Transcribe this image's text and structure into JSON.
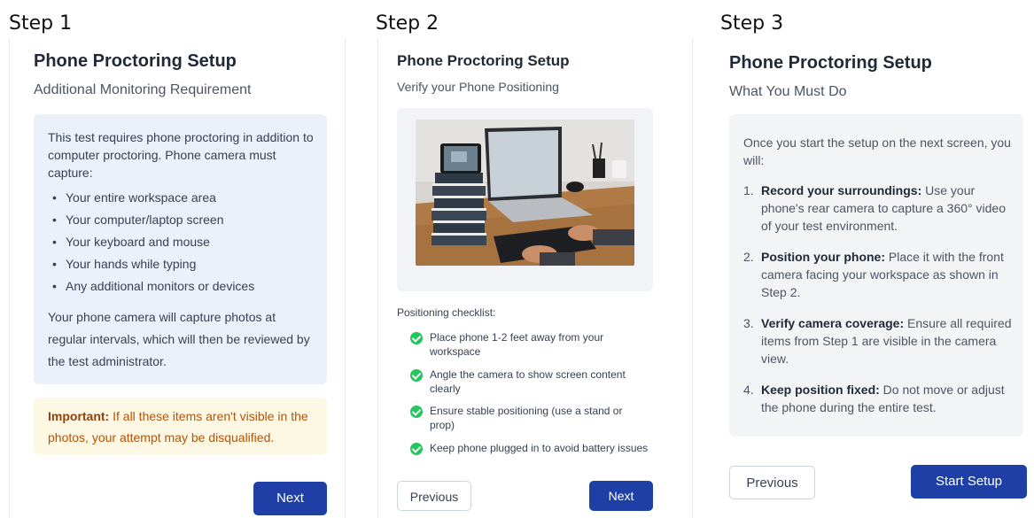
{
  "steps": {
    "step1_label": "Step 1",
    "step2_label": "Step 2",
    "step3_label": "Step 3"
  },
  "step1": {
    "title": "Phone Proctoring Setup",
    "subtitle": "Additional Monitoring Requirement",
    "intro": "This test requires phone proctoring in addition to computer proctoring. Phone camera must capture:",
    "items": [
      "Your entire workspace area",
      "Your computer/laptop screen",
      "Your keyboard and mouse",
      "Your hands while typing",
      "Any additional monitors or devices"
    ],
    "paragraph": "Your phone camera will capture photos at regular intervals, which will then be reviewed by the test administrator.",
    "warning_label": "Important:",
    "warning_text": " If all these items aren't visible in the photos, your attempt may be disqualified.",
    "next_label": "Next"
  },
  "step2": {
    "title": "Phone Proctoring Setup",
    "subtitle": "Verify your Phone Positioning",
    "checklist_title": "Positioning checklist:",
    "checklist": [
      "Place phone 1-2 feet away from your workspace",
      "Angle the camera to show screen content clearly",
      "Ensure stable positioning (use a stand or prop)",
      "Keep phone plugged in to avoid battery issues"
    ],
    "previous_label": "Previous",
    "next_label": "Next"
  },
  "step3": {
    "title": "Phone Proctoring Setup",
    "subtitle": "What You Must Do",
    "intro": "Once you start the setup on the next screen, you will:",
    "items": [
      {
        "num": "1.",
        "bold": "Record your surroundings:",
        "text": " Use your phone's rear camera to capture a 360° video of your test environment."
      },
      {
        "num": "2.",
        "bold": "Position your phone:",
        "text": " Place it with the front camera facing your workspace as shown in Step 2."
      },
      {
        "num": "3.",
        "bold": "Verify camera coverage:",
        "text": " Ensure all required items from Step 1 are visible in the camera view."
      },
      {
        "num": "4.",
        "bold": "Keep position fixed:",
        "text": " Do not move or adjust the phone during the entire test."
      }
    ],
    "previous_label": "Previous",
    "start_label": "Start Setup"
  },
  "colors": {
    "primary_button": "#1e3fa5",
    "info_box": "#eaf1fb",
    "warning_box": "#fdf8e4",
    "warning_text": "#b45309",
    "check_green": "#22c55e"
  }
}
